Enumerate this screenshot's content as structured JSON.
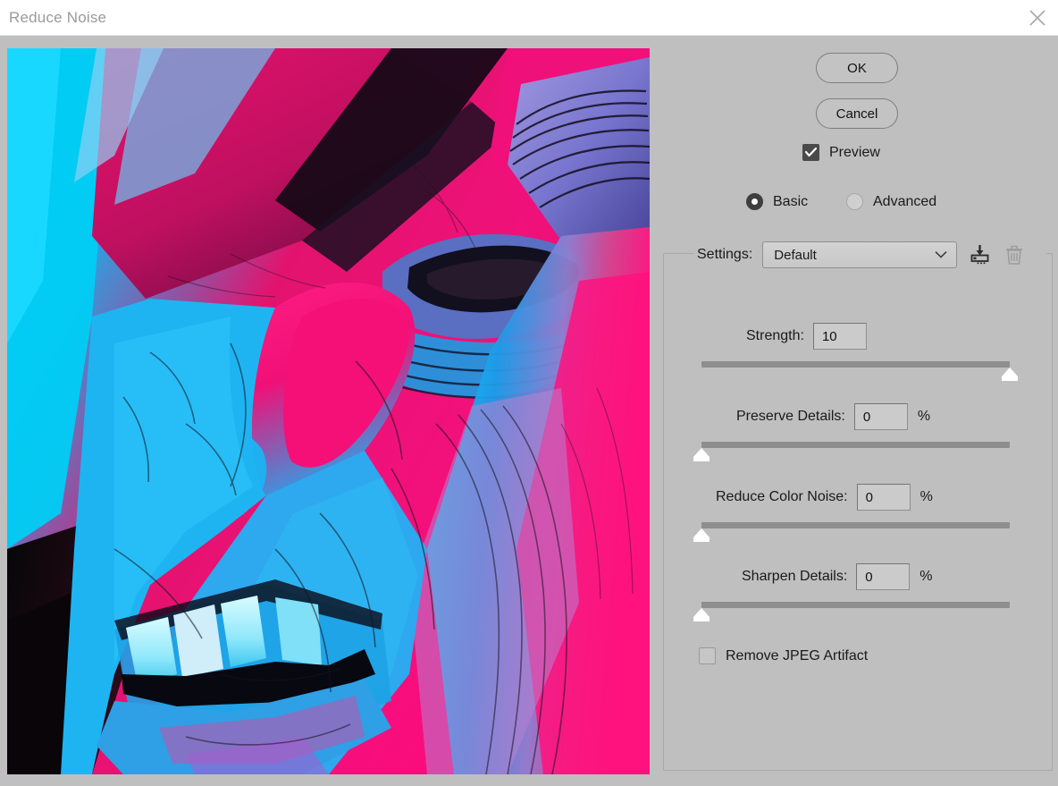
{
  "window": {
    "title": "Reduce Noise",
    "close_icon": "close-icon"
  },
  "buttons": {
    "ok": "OK",
    "cancel": "Cancel"
  },
  "preview": {
    "label": "Preview",
    "checked": true,
    "image_description": "Stylized posterized close-up of a face in profile with cyan, blue, magenta and pink tones"
  },
  "mode": {
    "basic": "Basic",
    "advanced": "Advanced",
    "selected": "Basic"
  },
  "settings": {
    "label": "Settings:",
    "value": "Default",
    "options": [
      "Default"
    ],
    "chevron_icon": "chevron-down-icon",
    "save_icon": "save-settings-icon",
    "delete_icon": "trash-icon"
  },
  "sliders": [
    {
      "id": "strength",
      "label": "Strength:",
      "value": "10",
      "unit": "",
      "min": 0,
      "max": 10,
      "percent": 100
    },
    {
      "id": "preserve-details",
      "label": "Preserve Details:",
      "value": "0",
      "unit": "%",
      "min": 0,
      "max": 100,
      "percent": 0
    },
    {
      "id": "reduce-color-noise",
      "label": "Reduce Color Noise:",
      "value": "0",
      "unit": "%",
      "min": 0,
      "max": 100,
      "percent": 0
    },
    {
      "id": "sharpen-details",
      "label": "Sharpen Details:",
      "value": "0",
      "unit": "%",
      "min": 0,
      "max": 100,
      "percent": 0
    }
  ],
  "jpeg": {
    "label": "Remove JPEG Artifact",
    "checked": false
  },
  "colors": {
    "dialog_bg": "#bfbfbf",
    "titlebar_bg": "#ffffff",
    "title_text": "#9a9a9a",
    "text": "#1a1a1a",
    "track": "#8e8e8e",
    "thumb": "#ffffff",
    "checkbox_checked": "#4a4a4a",
    "radio_selected": "#3f3f3f",
    "border": "#8f8f8f"
  }
}
